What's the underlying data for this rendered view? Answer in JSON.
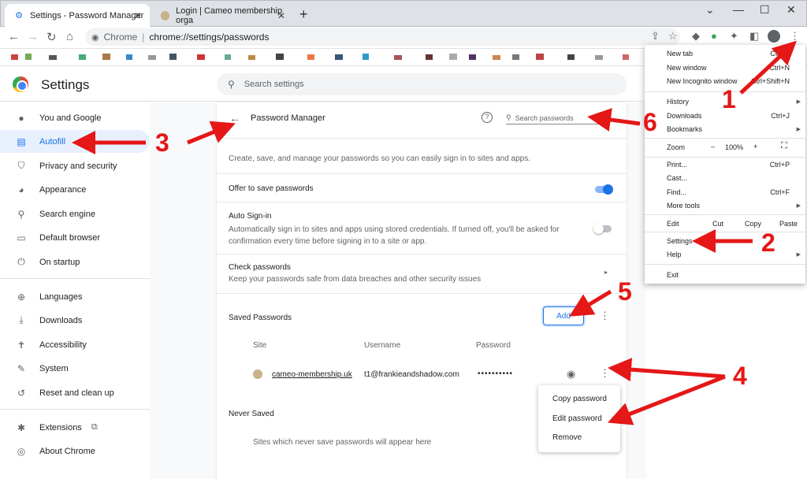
{
  "tabs": [
    {
      "label": "Settings - Password Manager"
    },
    {
      "label": "Login | Cameo membership orga"
    }
  ],
  "omnibox": {
    "site": "Chrome",
    "url": "chrome://settings/passwords"
  },
  "settings": {
    "title": "Settings",
    "search_placeholder": "Search settings"
  },
  "sidebar": {
    "items": [
      {
        "label": "You and Google",
        "icon": "person-icon"
      },
      {
        "label": "Autofill",
        "icon": "autofill-icon"
      },
      {
        "label": "Privacy and security",
        "icon": "shield-icon"
      },
      {
        "label": "Appearance",
        "icon": "palette-icon"
      },
      {
        "label": "Search engine",
        "icon": "search-icon"
      },
      {
        "label": "Default browser",
        "icon": "browser-icon"
      },
      {
        "label": "On startup",
        "icon": "power-icon"
      },
      {
        "label": "Languages",
        "icon": "globe-icon"
      },
      {
        "label": "Downloads",
        "icon": "download-icon"
      },
      {
        "label": "Accessibility",
        "icon": "accessibility-icon"
      },
      {
        "label": "System",
        "icon": "wrench-icon"
      },
      {
        "label": "Reset and clean up",
        "icon": "reset-icon"
      },
      {
        "label": "Extensions",
        "icon": "puzzle-icon"
      },
      {
        "label": "About Chrome",
        "icon": "chrome-icon"
      }
    ]
  },
  "password_manager": {
    "title": "Password Manager",
    "search_placeholder": "Search passwords",
    "intro": "Create, save, and manage your passwords so you can easily sign in to sites and apps.",
    "offer_save": "Offer to save passwords",
    "auto_signin_title": "Auto Sign-in",
    "auto_signin_desc": "Automatically sign in to sites and apps using stored credentials. If turned off, you'll be asked for confirmation every time before signing in to a site or app.",
    "check_title": "Check passwords",
    "check_desc": "Keep your passwords safe from data breaches and other security issues",
    "saved_title": "Saved Passwords",
    "add_label": "Add",
    "col_site": "Site",
    "col_username": "Username",
    "col_password": "Password",
    "entry": {
      "site": "cameo-membership.uk",
      "username": "t1@frankieandshadow.com",
      "password": "••••••••••"
    },
    "never_saved_title": "Never Saved",
    "never_saved_desc": "Sites which never save passwords will appear here",
    "row_menu": [
      "Copy password",
      "Edit password",
      "Remove"
    ]
  },
  "chrome_menu": {
    "new_tab": "New tab",
    "new_tab_sc": "Ctrl+T",
    "new_window": "New window",
    "new_window_sc": "Ctrl+N",
    "incognito": "New Incognito window",
    "incognito_sc": "Ctrl+Shift+N",
    "history": "History",
    "downloads": "Downloads",
    "downloads_sc": "Ctrl+J",
    "bookmarks": "Bookmarks",
    "zoom": "Zoom",
    "zoom_minus": "–",
    "zoom_value": "100%",
    "zoom_plus": "+",
    "print": "Print...",
    "print_sc": "Ctrl+P",
    "cast": "Cast...",
    "find": "Find...",
    "find_sc": "Ctrl+F",
    "more_tools": "More tools",
    "edit": "Edit",
    "cut": "Cut",
    "copy": "Copy",
    "paste": "Paste",
    "settings": "Settings",
    "help": "Help",
    "exit": "Exit"
  },
  "annotations": [
    "1",
    "2",
    "3",
    "4",
    "5",
    "6"
  ],
  "colors": {
    "accent": "#1a73e8",
    "annotation": "#e51717"
  }
}
